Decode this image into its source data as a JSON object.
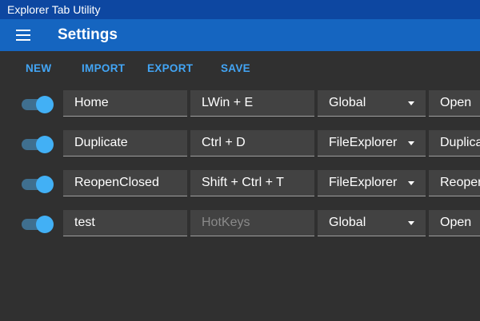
{
  "window": {
    "title": "Explorer Tab Utility"
  },
  "appbar": {
    "title": "Settings"
  },
  "toolbar": {
    "new": "NEW",
    "import": "IMPORT",
    "export": "EXPORT",
    "save": "SAVE"
  },
  "rows": [
    {
      "enabled": true,
      "name": "Home",
      "hotkey": "LWin + E",
      "hotkey_placeholder": "HotKeys",
      "scope": "Global",
      "action": "Open"
    },
    {
      "enabled": true,
      "name": "Duplicate",
      "hotkey": "Ctrl + D",
      "hotkey_placeholder": "HotKeys",
      "scope": "FileExplorer",
      "action": "Duplicate"
    },
    {
      "enabled": true,
      "name": "ReopenClosed",
      "hotkey": "Shift + Ctrl + T",
      "hotkey_placeholder": "HotKeys",
      "scope": "FileExplorer",
      "action": "ReopenClosed"
    },
    {
      "enabled": true,
      "name": "test",
      "hotkey": "",
      "hotkey_placeholder": "HotKeys",
      "scope": "Global",
      "action": "Open"
    }
  ],
  "colors": {
    "titlebar": "#0d47a1",
    "appbar": "#1565c0",
    "accent": "#42a5f5",
    "background": "#303030",
    "field": "#424242"
  }
}
